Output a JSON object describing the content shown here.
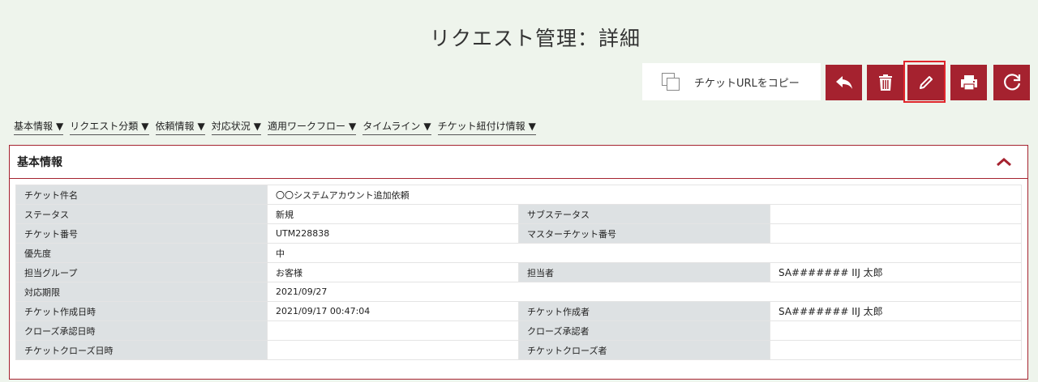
{
  "page": {
    "title": "リクエスト管理：詳細"
  },
  "toolbar": {
    "copy_label": "チケットURLをコピー",
    "buttons": [
      "reply-icon",
      "trash-icon",
      "pencil-icon",
      "print-icon",
      "refresh-icon"
    ],
    "accent": "#a5222f",
    "highlight_color": "#e0252b"
  },
  "tabs": [
    {
      "label": "基本情報",
      "arrow": "▼"
    },
    {
      "label": "リクエスト分類",
      "arrow": "▼"
    },
    {
      "label": "依頼情報",
      "arrow": "▼"
    },
    {
      "label": "対応状況",
      "arrow": "▼"
    },
    {
      "label": "適用ワークフロー",
      "arrow": "▼"
    },
    {
      "label": "タイムライン",
      "arrow": "▼"
    },
    {
      "label": "チケット紐付け情報",
      "arrow": "▼"
    }
  ],
  "panel": {
    "title": "基本情報",
    "rows": [
      {
        "label": "チケット件名",
        "value": "〇〇システムアカウント追加依頼"
      },
      {
        "label": "ステータス",
        "value": "新規",
        "label2": "サブステータス",
        "value2": ""
      },
      {
        "label": "チケット番号",
        "value": "UTM228838",
        "label2": "マスターチケット番号",
        "value2": ""
      },
      {
        "label": "優先度",
        "value": "中"
      },
      {
        "label": "担当グループ",
        "value": "お客様",
        "label2": "担当者",
        "value2": "SA####### IIJ 太郎"
      },
      {
        "label": "対応期限",
        "value": "2021/09/27"
      },
      {
        "label": "チケット作成日時",
        "value": "2021/09/17 00:47:04",
        "label2": "チケット作成者",
        "value2": "SA####### IIJ 太郎"
      },
      {
        "label": "クローズ承認日時",
        "value": "",
        "label2": "クローズ承認者",
        "value2": ""
      },
      {
        "label": "チケットクローズ日時",
        "value": "",
        "label2": "チケットクローズ者",
        "value2": ""
      }
    ]
  }
}
